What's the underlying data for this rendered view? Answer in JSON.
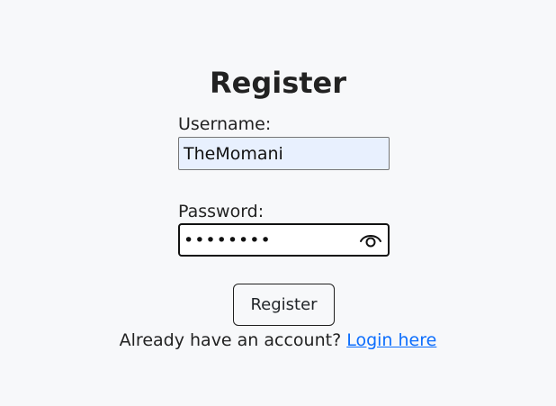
{
  "form": {
    "title": "Register",
    "username": {
      "label": "Username:",
      "value": "TheMomani"
    },
    "password": {
      "label": "Password:",
      "masked_value": "••••••••",
      "toggle_icon": "eye-icon"
    },
    "submit_label": "Register"
  },
  "footer": {
    "prompt": "Already have an account?",
    "link_label": "Login here"
  },
  "colors": {
    "background": "#f7f8fa",
    "link": "#0d6efd",
    "autofill": "#e8f0fe"
  }
}
